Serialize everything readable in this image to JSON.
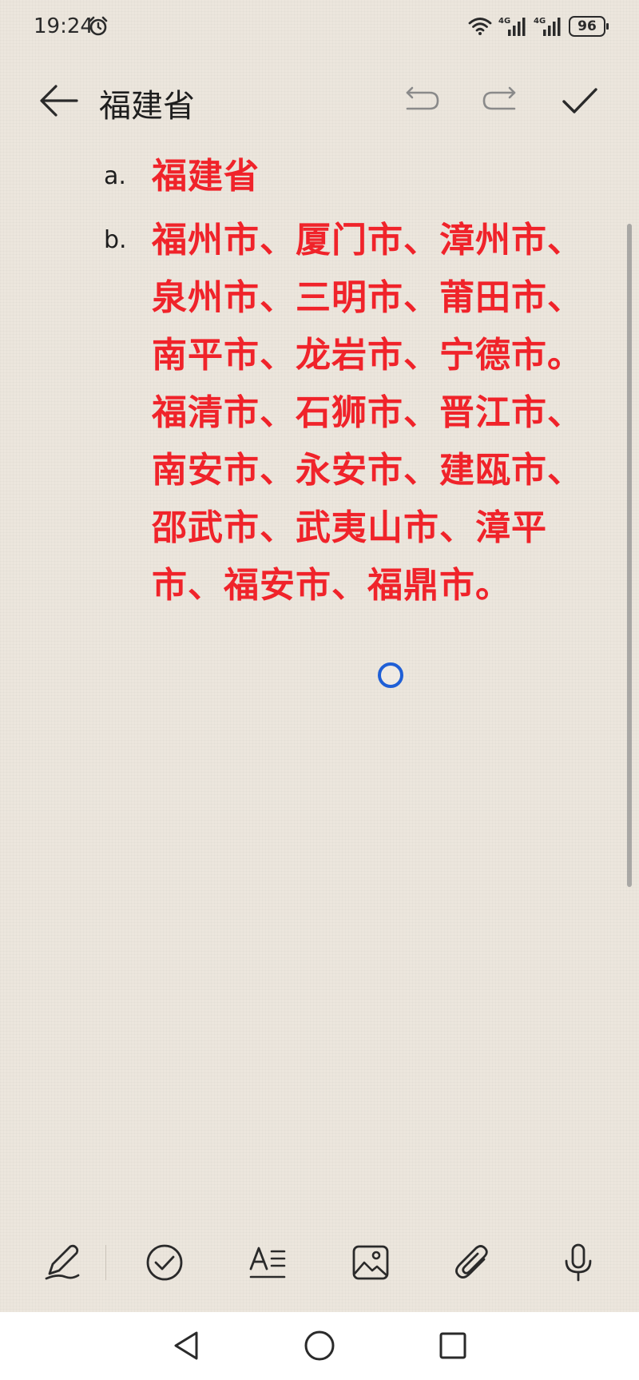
{
  "status_bar": {
    "time": "19:24",
    "network_1": "4G",
    "network_2": "4G",
    "battery": "96"
  },
  "header": {
    "title": "福建省"
  },
  "note": {
    "items": [
      {
        "marker": "a.",
        "text": "福建省"
      },
      {
        "marker": "b.",
        "text": "福州市、厦门市、漳州市、泉州市、三明市、莆田市、南平市、龙岩市、宁德市。 福清市、石狮市、晋江市、南安市、永安市、建瓯市、邵武市、武夷山市、漳平市、福安市、福鼎市。"
      }
    ],
    "text_color": "#f0232a"
  },
  "toolbar": {
    "icons": [
      "pen-icon",
      "checkbox-icon",
      "text-format-icon",
      "image-icon",
      "attachment-icon",
      "microphone-icon"
    ]
  },
  "navigation": {
    "icons": [
      "nav-back-icon",
      "nav-home-icon",
      "nav-recents-icon"
    ]
  }
}
